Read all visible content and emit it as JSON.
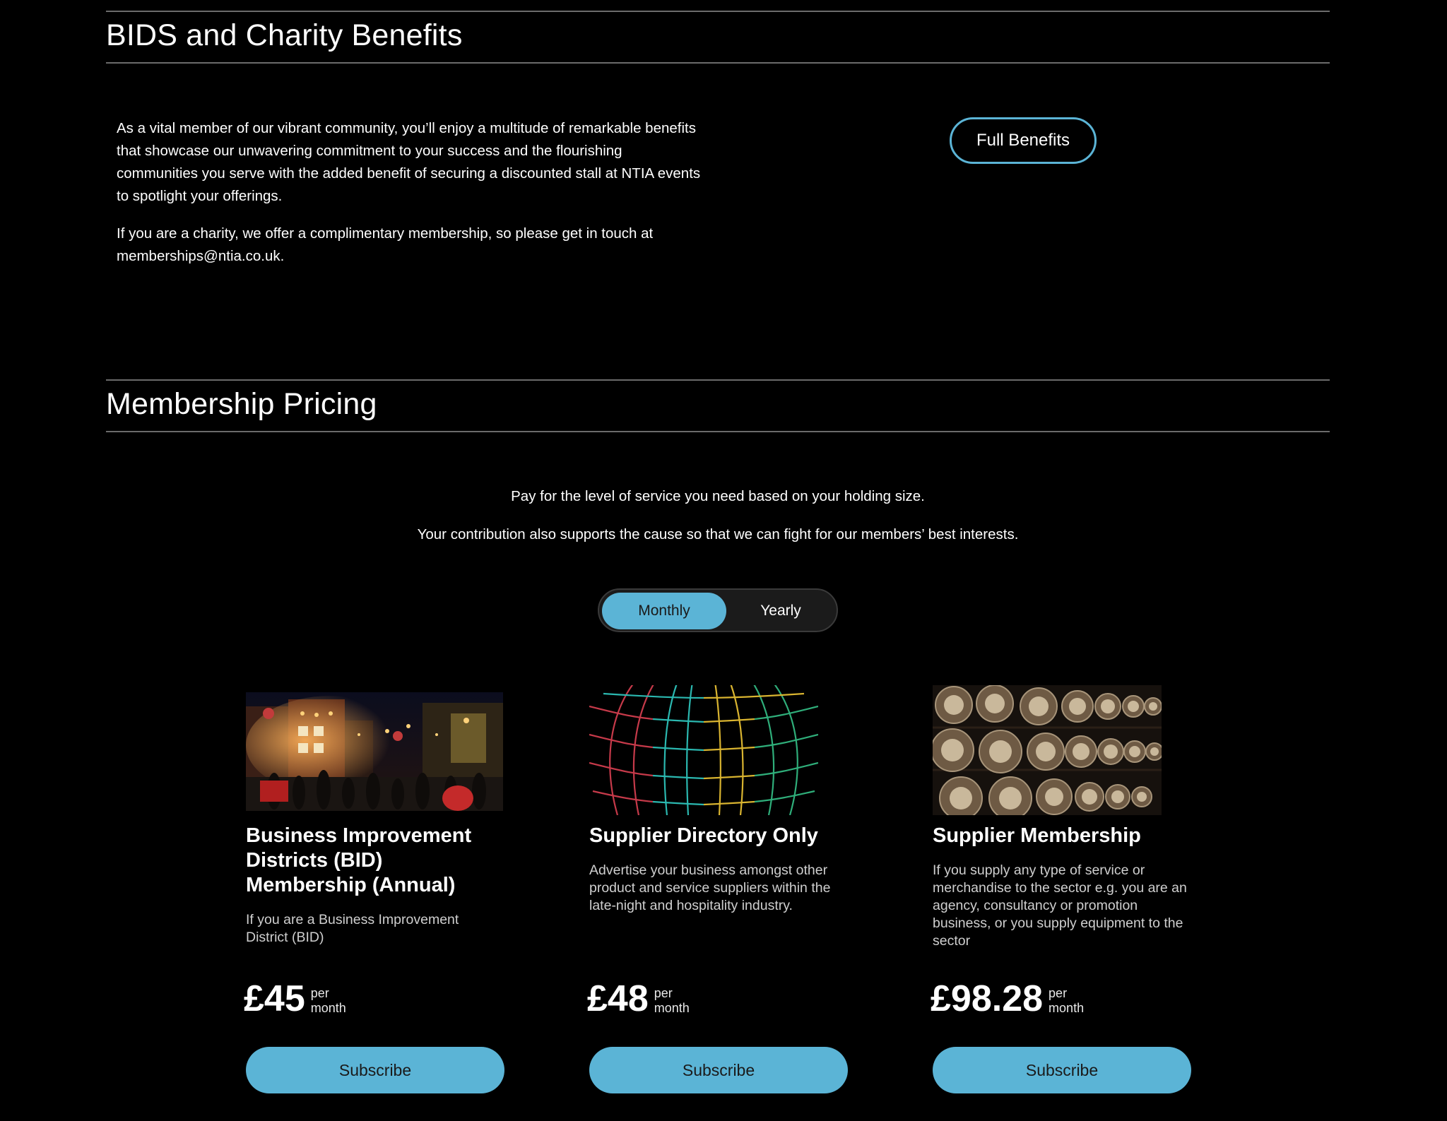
{
  "bids_section": {
    "title": "BIDS and Charity Benefits",
    "paragraph_1": "As a vital member of our vibrant community, you’ll enjoy a multitude of remarkable benefits that showcase our unwavering commitment to your success and the flourishing communities you serve with the added benefit of securing a discounted stall at NTIA events to spotlight your offerings.",
    "paragraph_2": "If you are a charity, we offer a complimentary membership, so please get in touch at memberships@ntia.co.uk.",
    "full_benefits_label": "Full Benefits"
  },
  "pricing_section": {
    "title": "Membership Pricing",
    "intro_1": "Pay for the level of service you need based on your holding size.",
    "intro_2": "Your contribution also supports the cause so that we can fight for our members’ best interests.",
    "toggle": {
      "monthly_label": "Monthly",
      "yearly_label": "Yearly",
      "selected": "Monthly"
    },
    "plans": [
      {
        "title": "Business Improvement Districts (BID) Membership (Annual)",
        "description": "If you are a Business Improvement District (BID)",
        "price": "£45",
        "per_line_1": "per",
        "per_line_2": "month",
        "button_label": "Subscribe",
        "image": "night-street-photo"
      },
      {
        "title": "Supplier Directory Only",
        "description": "Advertise your business amongst other product and service suppliers within the late-night and hospitality industry.",
        "price": "£48",
        "per_line_1": "per",
        "per_line_2": "month",
        "button_label": "Subscribe",
        "image": "globe-grid-graphic"
      },
      {
        "title": "Supplier Membership",
        "description": "If you supply any type of service or merchandise to the sector e.g. you are an agency, consultancy or promotion business, or you supply equipment to the sector",
        "price": "£98.28",
        "per_line_1": "per",
        "per_line_2": "month",
        "button_label": "Subscribe",
        "image": "barrels-photo"
      }
    ]
  },
  "colors": {
    "background": "#000000",
    "accent": "#5bb4d6",
    "rule": "#6b6b6b"
  }
}
